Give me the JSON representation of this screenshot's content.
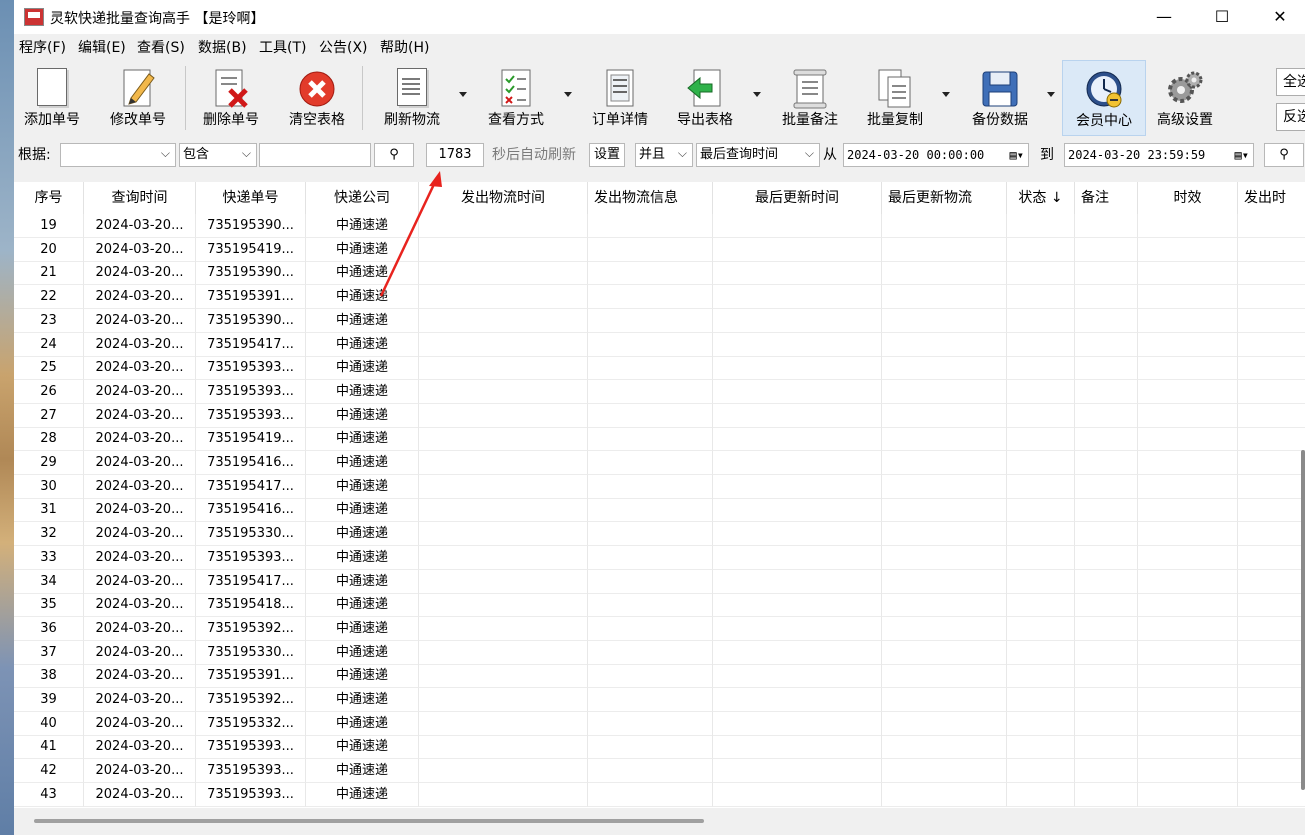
{
  "window": {
    "title": "灵软快递批量查询高手 【是玲啊】",
    "minimize": "—",
    "maximize": "☐",
    "close": "✕"
  },
  "menu": [
    "程序(F)",
    "编辑(E)",
    "查看(S)",
    "数据(B)",
    "工具(T)",
    "公告(X)",
    "帮助(H)"
  ],
  "toolbar": {
    "add": "添加单号",
    "edit": "修改单号",
    "delete": "删除单号",
    "clear": "清空表格",
    "refresh": "刷新物流",
    "view_mode": "查看方式",
    "order_detail": "订单详情",
    "export": "导出表格",
    "batch_note": "批量备注",
    "batch_copy": "批量复制",
    "backup": "备份数据",
    "member": "会员中心",
    "advanced": "高级设置",
    "select_all": "全选",
    "invert": "反选"
  },
  "filter": {
    "basis_label": "根据:",
    "basis_value": "",
    "match_value": "包含",
    "keyword": "",
    "seconds": "1783",
    "auto_refresh_label": "秒后自动刷新",
    "set_button": "设置",
    "and_value": "并且",
    "field_value": "最后查询时间",
    "from_label": "从",
    "from_date": "2024-03-20 00:00:00",
    "to_label": "到",
    "to_date": "2024-03-20 23:59:59"
  },
  "table": {
    "columns": [
      "序号",
      "查询时间",
      "快递单号",
      "快递公司",
      "发出物流时间",
      "发出物流信息",
      "最后更新时间",
      "最后更新物流",
      "状态 ↓",
      "备注",
      "时效",
      "发出时"
    ],
    "rows": [
      [
        "19",
        "2024-03-20...",
        "735195390...",
        "中通速递"
      ],
      [
        "20",
        "2024-03-20...",
        "735195419...",
        "中通速递"
      ],
      [
        "21",
        "2024-03-20...",
        "735195390...",
        "中通速递"
      ],
      [
        "22",
        "2024-03-20...",
        "735195391...",
        "中通速递"
      ],
      [
        "23",
        "2024-03-20...",
        "735195390...",
        "中通速递"
      ],
      [
        "24",
        "2024-03-20...",
        "735195417...",
        "中通速递"
      ],
      [
        "25",
        "2024-03-20...",
        "735195393...",
        "中通速递"
      ],
      [
        "26",
        "2024-03-20...",
        "735195393...",
        "中通速递"
      ],
      [
        "27",
        "2024-03-20...",
        "735195393...",
        "中通速递"
      ],
      [
        "28",
        "2024-03-20...",
        "735195419...",
        "中通速递"
      ],
      [
        "29",
        "2024-03-20...",
        "735195416...",
        "中通速递"
      ],
      [
        "30",
        "2024-03-20...",
        "735195417...",
        "中通速递"
      ],
      [
        "31",
        "2024-03-20...",
        "735195416...",
        "中通速递"
      ],
      [
        "32",
        "2024-03-20...",
        "735195330...",
        "中通速递"
      ],
      [
        "33",
        "2024-03-20...",
        "735195393...",
        "中通速递"
      ],
      [
        "34",
        "2024-03-20...",
        "735195417...",
        "中通速递"
      ],
      [
        "35",
        "2024-03-20...",
        "735195418...",
        "中通速递"
      ],
      [
        "36",
        "2024-03-20...",
        "735195392...",
        "中通速递"
      ],
      [
        "37",
        "2024-03-20...",
        "735195330...",
        "中通速递"
      ],
      [
        "38",
        "2024-03-20...",
        "735195391...",
        "中通速递"
      ],
      [
        "39",
        "2024-03-20...",
        "735195392...",
        "中通速递"
      ],
      [
        "40",
        "2024-03-20...",
        "735195332...",
        "中通速递"
      ],
      [
        "41",
        "2024-03-20...",
        "735195393...",
        "中通速递"
      ],
      [
        "42",
        "2024-03-20...",
        "735195393...",
        "中通速递"
      ],
      [
        "43",
        "2024-03-20...",
        "735195393...",
        "中通速递"
      ]
    ]
  },
  "colors": {
    "annotation_arrow": "#e8231e",
    "window_bg": "#f0f0f0",
    "member_highlight": "#dbe9f7"
  }
}
